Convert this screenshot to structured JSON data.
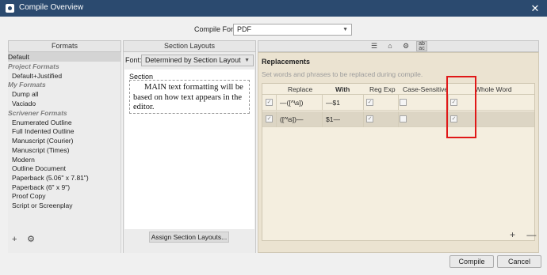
{
  "window": {
    "title": "Compile Overview",
    "close_glyph": "✕"
  },
  "compile_for": {
    "label": "Compile For:",
    "value": "PDF"
  },
  "panels": {
    "formats_header": "Formats",
    "section_layouts_header": "Section Layouts"
  },
  "formats": [
    {
      "label": "Default",
      "kind": "item",
      "selected": true
    },
    {
      "label": "Project Formats",
      "kind": "group"
    },
    {
      "label": "Default+Justified",
      "kind": "indent"
    },
    {
      "label": "My Formats",
      "kind": "group"
    },
    {
      "label": "Dump all",
      "kind": "indent"
    },
    {
      "label": "Vaciado",
      "kind": "indent"
    },
    {
      "label": "Scrivener Formats",
      "kind": "group"
    },
    {
      "label": "Enumerated Outline",
      "kind": "indent"
    },
    {
      "label": "Full Indented Outline",
      "kind": "indent"
    },
    {
      "label": "Manuscript (Courier)",
      "kind": "indent"
    },
    {
      "label": "Manuscript (Times)",
      "kind": "indent"
    },
    {
      "label": "Modern",
      "kind": "indent"
    },
    {
      "label": "Outline Document",
      "kind": "indent"
    },
    {
      "label": "Paperback (5.06\" x 7.81\")",
      "kind": "indent"
    },
    {
      "label": "Paperback (6\" x 9\")",
      "kind": "indent"
    },
    {
      "label": "Proof Copy",
      "kind": "indent"
    },
    {
      "label": "Script or Screenplay",
      "kind": "indent"
    }
  ],
  "formats_footer": {
    "add_glyph": "+",
    "settings_glyph": "⚙"
  },
  "section": {
    "font_label": "Font:",
    "font_value": "Determined by Section Layout",
    "preview_label": "Section",
    "preview_text": "MAIN text formatting will be based on how text appears in the editor.",
    "assign_button": "Assign Section Layouts..."
  },
  "toolbar_icons": [
    {
      "name": "list-icon",
      "glyph": "☰"
    },
    {
      "name": "tag-icon",
      "glyph": "⌂"
    },
    {
      "name": "gear-icon",
      "glyph": "⚙"
    },
    {
      "name": "replacements-icon",
      "glyph": "ab ac",
      "active": true
    }
  ],
  "replacements": {
    "title": "Replacements",
    "subtitle": "Set words and phrases to be replaced during compile.",
    "columns": [
      "Replace",
      "With",
      "Reg Exp",
      "Case-Sensitive",
      "Whole Word"
    ],
    "rows": [
      {
        "enabled": true,
        "replace": "—([^\\s])",
        "with": "—$1",
        "reg_exp": true,
        "case_sensitive": false,
        "whole_word": true
      },
      {
        "enabled": true,
        "replace": "([^\\s])—",
        "with": "$1—",
        "reg_exp": true,
        "case_sensitive": false,
        "whole_word": true
      }
    ],
    "add_glyph": "+",
    "remove_glyph": "—"
  },
  "buttons": {
    "compile": "Compile",
    "cancel": "Cancel"
  },
  "colors": {
    "titlebar": "#2b4a6f",
    "replacements_bg": "#ebe3d1",
    "highlight": "#e01818"
  }
}
